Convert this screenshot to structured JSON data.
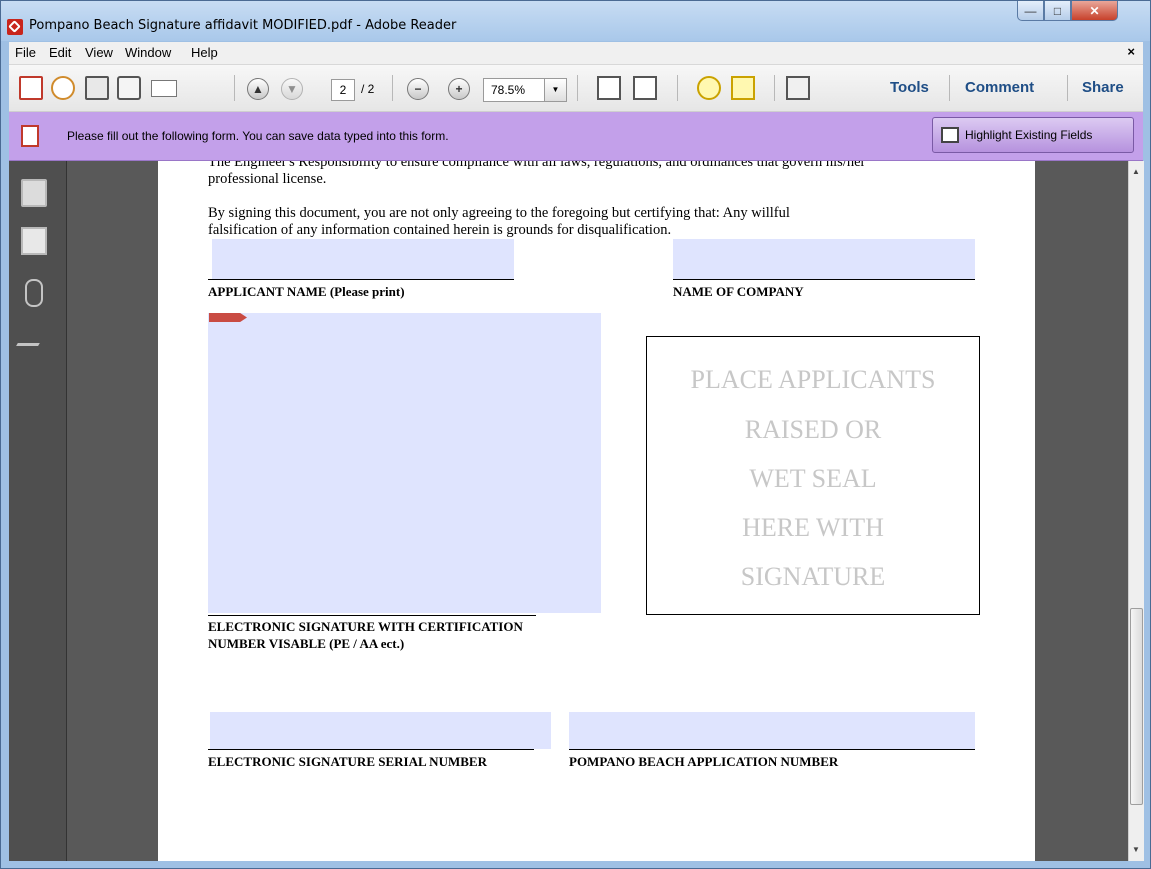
{
  "window": {
    "title": "Pompano Beach Signature affidavit MODIFIED.pdf - Adobe Reader"
  },
  "menu": {
    "items": [
      "File",
      "Edit",
      "View",
      "Window",
      "Help"
    ],
    "close": "×"
  },
  "toolbar": {
    "page_current": "2",
    "page_total": "/ 2",
    "zoom": "78.5%",
    "zoom_dropdown": "▼",
    "tools": "Tools",
    "comment": "Comment",
    "share": "Share"
  },
  "formbar": {
    "message": "Please fill out the following form. You can save data typed into this form.",
    "highlight_button": "Highlight Existing Fields"
  },
  "document": {
    "cut_top_line": "The Engineer's Responsibility to ensure compliance with all laws, regulations, and ordinances that govern his/her",
    "line_license": "professional license.",
    "para_line1": "By signing this document, you are not only agreeing to the foregoing but certifying that: Any willful",
    "para_line2": "falsification of any information contained herein is grounds for disqualification.",
    "label_applicant": "APPLICANT NAME (Please print)",
    "label_company": "NAME OF COMPANY",
    "label_esig_line1": "ELECTRONIC SIGNATURE WITH CERTIFICATION",
    "label_esig_line2": "NUMBER VISABLE (PE / AA ect.)",
    "seal_lines": [
      "PLACE APPLICANTS",
      "RAISED OR",
      "WET SEAL",
      "HERE WITH",
      "SIGNATURE"
    ],
    "label_serial": "ELECTRONIC SIGNATURE SERIAL NUMBER",
    "label_app_number": "POMPANO BEACH APPLICATION NUMBER"
  },
  "colors": {
    "form_bar": "#c3a0ea",
    "field_fill": "#dfe4fe",
    "nav_panel": "#4f4f4f",
    "doc_background": "#595959"
  }
}
